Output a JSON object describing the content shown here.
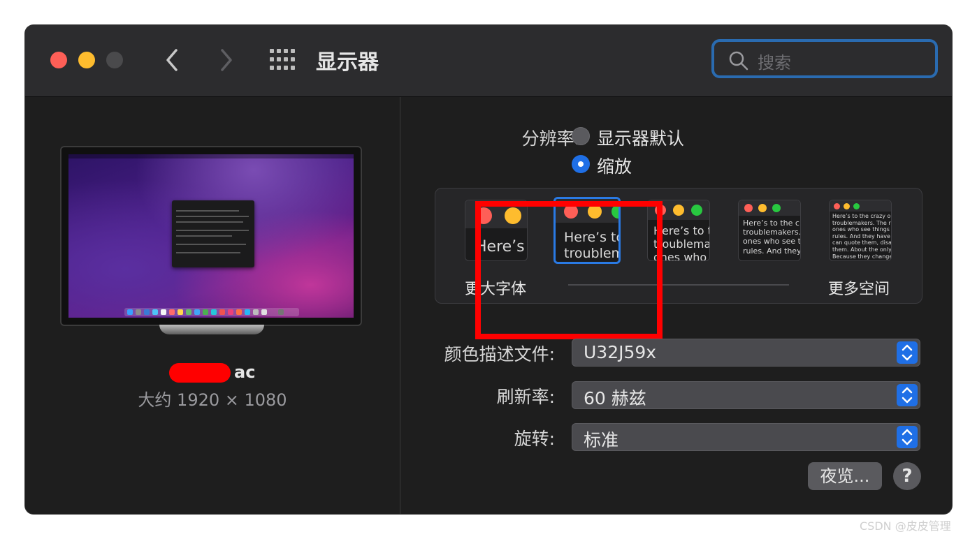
{
  "window": {
    "title": "显示器",
    "search_placeholder": "搜索"
  },
  "sidebar": {
    "display_name_suffix": "ac",
    "display_size": "大约 1920 × 1080"
  },
  "resolution": {
    "label": "分辨率:",
    "options": [
      {
        "label": "显示器默认",
        "selected": false
      },
      {
        "label": "缩放",
        "selected": true
      }
    ]
  },
  "scaling": {
    "left_label": "更大字体",
    "right_label": "更多空间",
    "thumbs": [
      {
        "text": "Here’s",
        "selected": false
      },
      {
        "text": "Here’s to\ntroublem",
        "selected": true
      },
      {
        "text": "Here’s to t\ntroublema\nones who",
        "selected": false
      },
      {
        "text": "Here’s to the cr\ntroublemakers.\nones who see t\nrules. And they",
        "selected": false
      },
      {
        "text": "Here’s to the crazy ones\ntroublemakers. The rou\nones who see things dif\nrules. And they have no\ncan quote them, disagre\nthem. About the only th\nBecause they change th",
        "selected": false
      }
    ]
  },
  "settings": [
    {
      "label": "颜色描述文件:",
      "value": "U32J59x"
    },
    {
      "label": "刷新率:",
      "value": "60 赫兹"
    },
    {
      "label": "旋转:",
      "value": "标准"
    }
  ],
  "buttons": {
    "night_shift": "夜览...",
    "help": "?"
  },
  "watermark": "CSDN @皮皮管理",
  "colors": {
    "accent": "#1f6fe6",
    "highlight": "#ff0000",
    "close": "#fe5f57",
    "minimize": "#febc2e",
    "zoom": "#4a4a4c"
  }
}
